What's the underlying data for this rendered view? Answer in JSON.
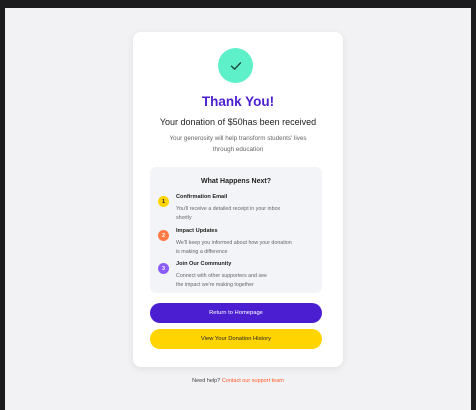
{
  "colors": {
    "primary": "#4b1fd1",
    "accent_yellow": "#ffd400",
    "success": "#5ef0c9",
    "link": "#ff5a2a"
  },
  "confirmation": {
    "icon": "check-icon",
    "title": "Thank You!",
    "subtitle": "Your donation of $50has been received",
    "message_line1": "Your generosity will help transform students' lives",
    "message_line2": "through education"
  },
  "next_steps": {
    "title": "What Happens Next?",
    "steps": [
      {
        "number": "1",
        "title": "Confirmation Email",
        "desc_line1": "You'll receive a detailed receipt in your inbox",
        "desc_line2": "shortly",
        "color": "#ffd400"
      },
      {
        "number": "2",
        "title": "Impact Updates",
        "desc_line1": "We'll keep you informed about how your donation",
        "desc_line2": "is making a difference",
        "color": "#ff7a45"
      },
      {
        "number": "3",
        "title": "Join Our Community",
        "desc_line1": "Connect with other supporters and see",
        "desc_line2": "the impact we're making together",
        "color": "#8b5cf6"
      }
    ]
  },
  "actions": {
    "primary_label": "Return to Homepage",
    "secondary_label": "View Your Donation History"
  },
  "footer": {
    "help_text": "Need help?",
    "help_link": "Contact our support team"
  }
}
